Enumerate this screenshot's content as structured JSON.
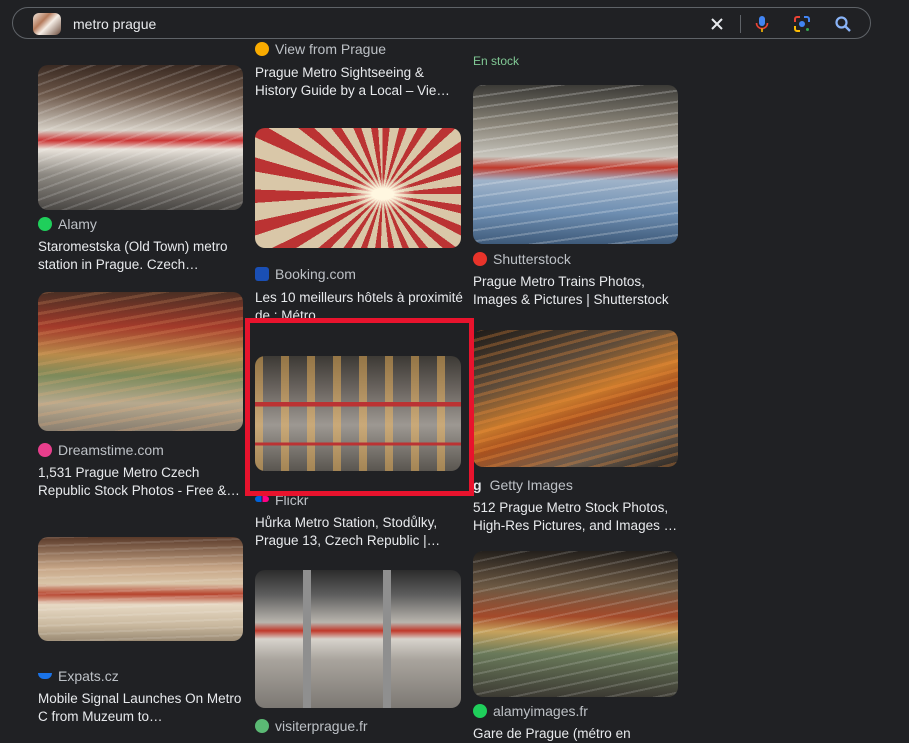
{
  "search": {
    "query": "metro prague",
    "icons": [
      "close-icon",
      "microphone-icon",
      "google-lens-icon",
      "search-icon"
    ]
  },
  "results": {
    "col1": [
      {
        "source": "Alamy",
        "title": "Staromestska (Old Town) metro station in Prague. Czech…",
        "favicon_color": "#1fcf5b",
        "watermark": "alamy"
      },
      {
        "source": "Dreamstime.com",
        "title": "1,531 Prague Metro Czech Republic Stock Photos - Free &…",
        "favicon_color": "#e83e8c"
      },
      {
        "source": "Expats.cz",
        "title": "Mobile Signal Launches On Metro C from Muzeum to…",
        "favicon_color": "#1a73e8"
      }
    ],
    "col2": [
      {
        "source": "View from Prague",
        "title": "Prague Metro Sightseeing & History Guide by a Local – Vie…",
        "favicon_color": "#f9ab00"
      },
      {
        "source": "Booking.com",
        "title": "Les 10 meilleurs hôtels à proximité de : Métro…",
        "favicon_color": "#1a4fb5",
        "favicon_letter": "B."
      },
      {
        "source": "Flickr",
        "title": "Hůrka Metro Station, Stodůlky, Prague 13, Czech Republic |…",
        "favicon_color": "#ff0084"
      },
      {
        "source": "visiterprague.fr",
        "title": "",
        "favicon_color": "#5bb974"
      }
    ],
    "col3": [
      {
        "stock_label": "En stock"
      },
      {
        "source": "Shutterstock",
        "title": "Prague Metro Trains Photos, Images & Pictures | Shutterstock",
        "favicon_color": "#e8332a",
        "watermark": "shutterstock"
      },
      {
        "source": "Getty Images",
        "title": "512 Prague Metro Stock Photos, High-Res Pictures, and Images …",
        "favicon_letter": "g",
        "watermark": "gettyimages"
      },
      {
        "source": "alamyimages.fr",
        "title": "Gare de Prague (métro en",
        "favicon_color": "#1fcf5b",
        "watermark": "alamy"
      }
    ]
  },
  "colors": {
    "highlight": "#e8132d",
    "background": "#202124"
  }
}
